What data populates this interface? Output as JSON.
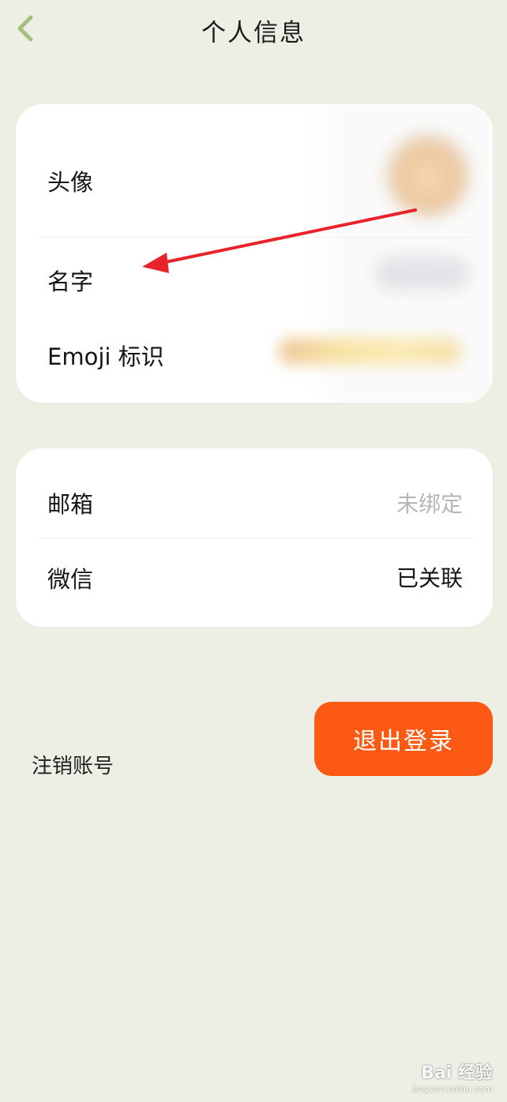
{
  "header": {
    "title": "个人信息",
    "back_icon": "chevron-left-icon",
    "back_color": "#a4c07a"
  },
  "profile_card": {
    "avatar_label": "头像",
    "name_label": "名字",
    "emoji_label": "Emoji 标识"
  },
  "binding_card": {
    "email_label": "邮箱",
    "email_value": "未绑定",
    "email_value_color": "#b6b6b6",
    "wechat_label": "微信",
    "wechat_value": "已关联"
  },
  "actions": {
    "cancel_account_label": "注销账号",
    "logout_label": "退出登录",
    "logout_color": "#fc5a14"
  },
  "annotation": {
    "arrow_color": "#e8232b"
  },
  "watermark": {
    "logo_text": "Bai 经验",
    "url": "jingyan.baidu.com"
  }
}
